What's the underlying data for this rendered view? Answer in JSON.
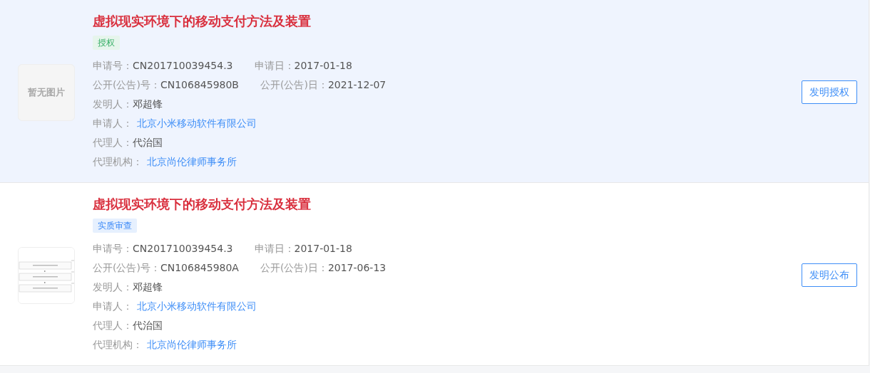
{
  "results": [
    {
      "highlighted": true,
      "thumbnail": {
        "kind": "placeholder",
        "text": "暂无图片"
      },
      "title": "虚拟现实环境下的移动支付方法及装置",
      "tag": {
        "text": "授权",
        "color": "#e6f5ec"
      },
      "lines": [
        [
          {
            "label": "申请号：",
            "value": "CN201710039454.3",
            "kind": "text"
          },
          {
            "label": "申请日：",
            "value": "2017-01-18",
            "kind": "text"
          }
        ],
        [
          {
            "label": "公开(公告)号：",
            "value": "CN106845980B",
            "kind": "text"
          },
          {
            "label": "公开(公告)日：",
            "value": "2021-12-07",
            "kind": "text"
          }
        ],
        [
          {
            "label": "发明人：",
            "value": "邓超锋",
            "kind": "text"
          }
        ],
        [
          {
            "label": "申请人：",
            "value": "北京小米移动软件有限公司",
            "kind": "link"
          }
        ],
        [
          {
            "label": "代理人：",
            "value": "代治国",
            "kind": "text"
          }
        ],
        [
          {
            "label": "代理机构：",
            "value": "北京尚伦律师事务所",
            "kind": "link"
          }
        ]
      ],
      "button": "发明授权"
    },
    {
      "highlighted": false,
      "thumbnail": {
        "kind": "picture"
      },
      "title": "虚拟现实环境下的移动支付方法及装置",
      "tag": {
        "text": "实质审查",
        "color": "#e6f0fe"
      },
      "lines": [
        [
          {
            "label": "申请号：",
            "value": "CN201710039454.3",
            "kind": "text"
          },
          {
            "label": "申请日：",
            "value": "2017-01-18",
            "kind": "text"
          }
        ],
        [
          {
            "label": "公开(公告)号：",
            "value": "CN106845980A",
            "kind": "text"
          },
          {
            "label": "公开(公告)日：",
            "value": "2017-06-13",
            "kind": "text"
          }
        ],
        [
          {
            "label": "发明人：",
            "value": "邓超锋",
            "kind": "text"
          }
        ],
        [
          {
            "label": "申请人：",
            "value": "北京小米移动软件有限公司",
            "kind": "link"
          }
        ],
        [
          {
            "label": "代理人：",
            "value": "代治国",
            "kind": "text"
          }
        ],
        [
          {
            "label": "代理机构：",
            "value": "北京尚伦律师事务所",
            "kind": "link"
          }
        ]
      ],
      "button": "发明公布"
    }
  ]
}
